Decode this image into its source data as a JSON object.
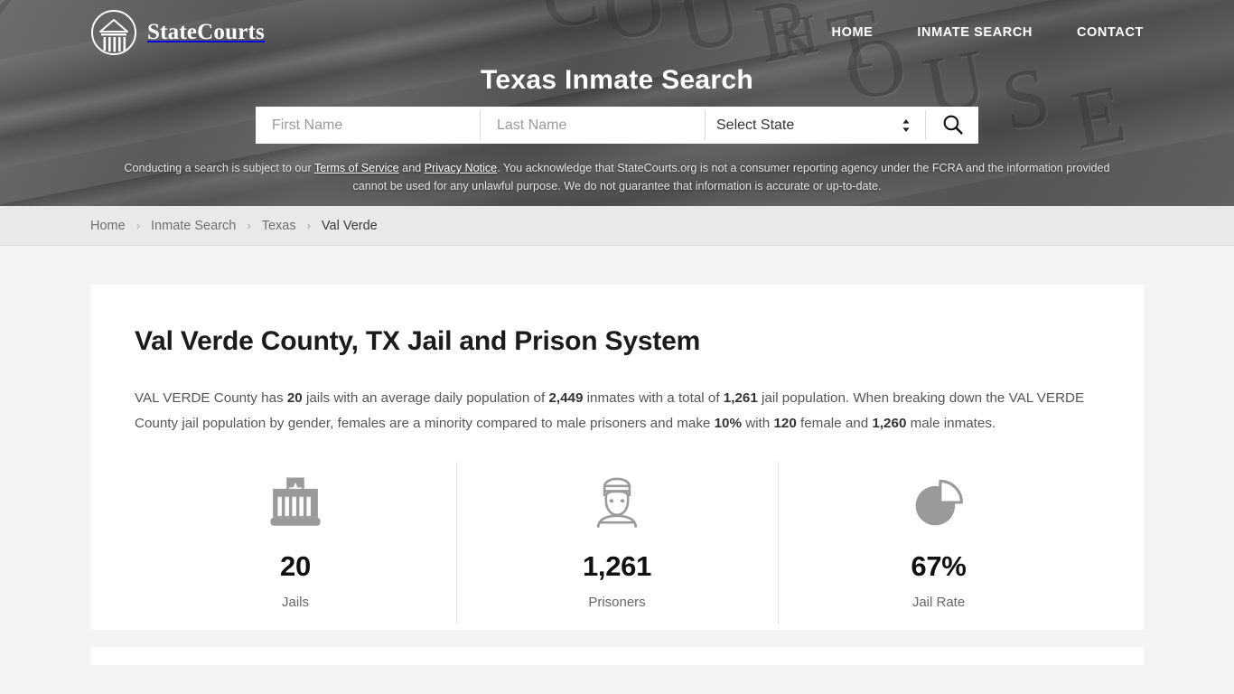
{
  "header": {
    "brand_name": "StateCourts",
    "brand_icon": "courthouse-logo-icon",
    "nav": [
      {
        "label": "HOME",
        "name": "nav-home"
      },
      {
        "label": "INMATE SEARCH",
        "name": "nav-inmate-search"
      },
      {
        "label": "CONTACT",
        "name": "nav-contact"
      }
    ],
    "hero_title": "Texas Inmate Search",
    "background_letters": "COURT HOUSE"
  },
  "search": {
    "first_name_placeholder": "First Name",
    "first_name_value": "",
    "last_name_placeholder": "Last Name",
    "last_name_value": "",
    "state_selected": "Select State",
    "search_icon": "magnifier-icon",
    "spinner_icon": "chevron-up-down-icon"
  },
  "disclaimer": {
    "part1": "Conducting a search is subject to our ",
    "link1": "Terms of Service",
    "part2": " and ",
    "link2": "Privacy Notice",
    "part3": ". You acknowledge that StateCourts.org is not a consumer reporting agency under the FCRA and the information provided cannot be used for any unlawful purpose. We do not guarantee that information is accurate or up-to-date."
  },
  "breadcrumb": {
    "items": [
      {
        "label": "Home",
        "current": false
      },
      {
        "label": "Inmate Search",
        "current": false
      },
      {
        "label": "Texas",
        "current": false
      },
      {
        "label": "Val Verde",
        "current": true
      }
    ],
    "separator": "›"
  },
  "main": {
    "title": "Val Verde County, TX Jail and Prison System",
    "paragraph": {
      "t1": "VAL VERDE County has ",
      "b1": "20",
      "t2": " jails with an average daily population of ",
      "b2": "2,449",
      "t3": " inmates with a total of ",
      "b3": "1,261",
      "t4": " jail population. When breaking down the VAL VERDE County jail population by gender, females are a minority compared to male prisoners and make ",
      "b4": "10%",
      "t5": " with ",
      "b5": "120",
      "t6": " female and ",
      "b6": "1,260",
      "t7": " male inmates."
    },
    "stats": [
      {
        "value": "20",
        "label": "Jails",
        "icon": "jail-building-icon"
      },
      {
        "value": "1,261",
        "label": "Prisoners",
        "icon": "prisoner-icon"
      },
      {
        "value": "67%",
        "label": "Jail Rate",
        "icon": "pie-chart-icon"
      }
    ]
  },
  "colors": {
    "hero_bg": "#5a5a5a",
    "page_bg": "#f4f4f4",
    "card_bg": "#ffffff",
    "crumb_bg": "#e9e9e9",
    "icon_gray": "#9a9a9a",
    "text_dark": "#111111",
    "text_body": "#555555"
  }
}
